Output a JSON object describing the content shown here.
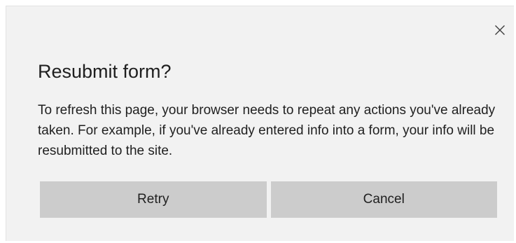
{
  "dialog": {
    "title": "Resubmit form?",
    "message": "To refresh this page, your browser needs to repeat any actions you've already taken. For example, if you've already entered info into a form, your info will be resubmitted to the site.",
    "close_icon": "close-icon",
    "buttons": {
      "retry": "Retry",
      "cancel": "Cancel"
    }
  },
  "colors": {
    "dialog_background": "#f2f2f2",
    "button_background": "#cccccc",
    "text": "#1f1f1f"
  }
}
